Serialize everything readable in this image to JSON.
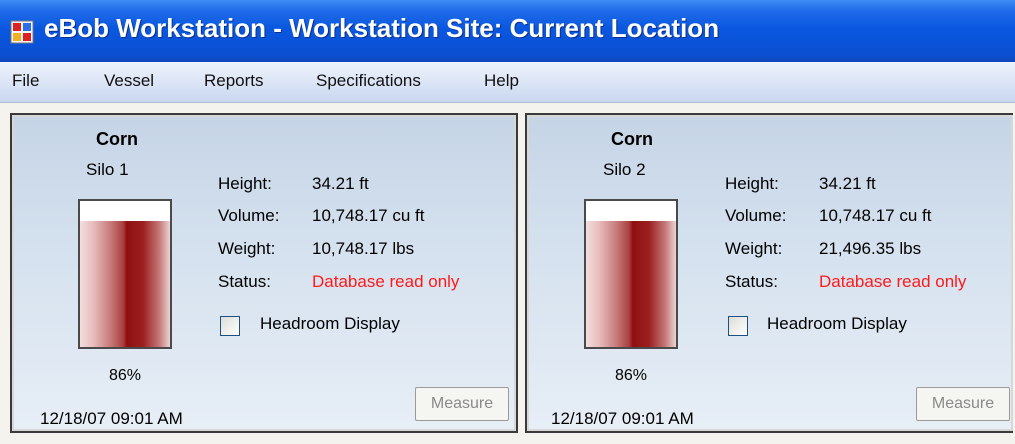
{
  "window": {
    "title": "eBob Workstation - Workstation Site: Current Location",
    "icon": "app-icon"
  },
  "menu": [
    "File",
    "Vessel",
    "Reports",
    "Specifications",
    "Help"
  ],
  "labels": {
    "height": "Height:",
    "volume": "Volume:",
    "weight": "Weight:",
    "status": "Status:",
    "headroom": "Headroom Display",
    "measure": "Measure"
  },
  "silos": [
    {
      "product": "Corn",
      "name": "Silo 1",
      "height": "34.21 ft",
      "volume": "10,748.17 cu ft",
      "weight": "10,748.17 lbs",
      "status": "Database read only",
      "percent_text": "86%",
      "fill_fraction": 0.86,
      "timestamp": "12/18/07 09:01 AM",
      "headroom_checked": false
    },
    {
      "product": "Corn",
      "name": "Silo 2",
      "height": "34.21 ft",
      "volume": "10,748.17 cu ft",
      "weight": "21,496.35 lbs",
      "status": "Database read only",
      "percent_text": "86%",
      "fill_fraction": 0.86,
      "timestamp": "12/18/07 09:01 AM",
      "headroom_checked": false
    }
  ],
  "colors": {
    "title_bar": "#0a58e0",
    "status_text": "#ff1a1a",
    "tank_fill": "#8f0f0f"
  }
}
